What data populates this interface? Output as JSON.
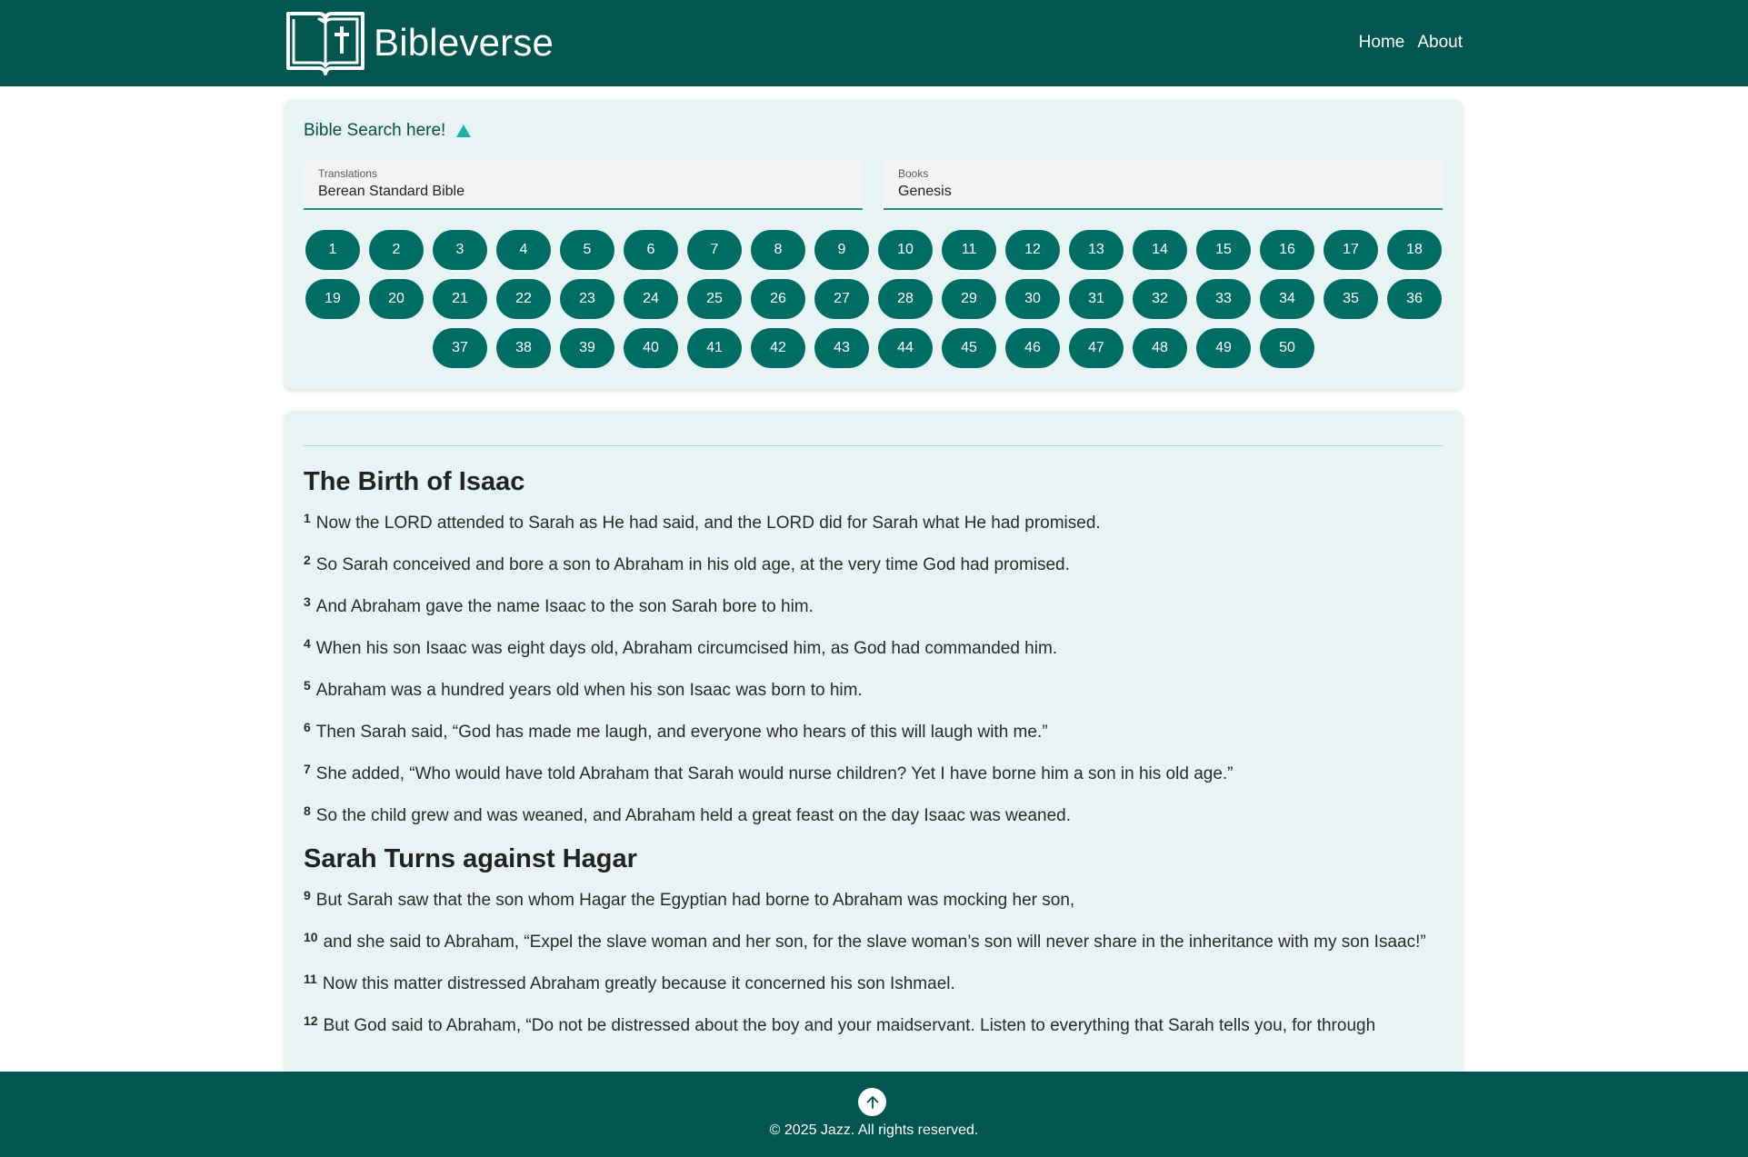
{
  "brand": {
    "name": "Bibleverse",
    "logo_icon": "open-bible-cross-icon"
  },
  "nav": {
    "home": "Home",
    "about": "About"
  },
  "search": {
    "title": "Bible Search here!",
    "toggle_icon": "triangle-up-icon",
    "translations_label": "Translations",
    "translations_value": "Berean Standard Bible",
    "books_label": "Books",
    "books_value": "Genesis",
    "chapters": [
      "1",
      "2",
      "3",
      "4",
      "5",
      "6",
      "7",
      "8",
      "9",
      "10",
      "11",
      "12",
      "13",
      "14",
      "15",
      "16",
      "17",
      "18",
      "19",
      "20",
      "21",
      "22",
      "23",
      "24",
      "25",
      "26",
      "27",
      "28",
      "29",
      "30",
      "31",
      "32",
      "33",
      "34",
      "35",
      "36",
      "37",
      "38",
      "39",
      "40",
      "41",
      "42",
      "43",
      "44",
      "45",
      "46",
      "47",
      "48",
      "49",
      "50"
    ]
  },
  "sections": [
    {
      "heading": "The Birth of Isaac",
      "verses": [
        {
          "num": "1",
          "text": "Now the LORD attended to Sarah as He had said, and the LORD did for Sarah what He had promised."
        },
        {
          "num": "2",
          "text": "So Sarah conceived and bore a son to Abraham in his old age, at the very time God had promised."
        },
        {
          "num": "3",
          "text": "And Abraham gave the name Isaac   to the son Sarah bore to him."
        },
        {
          "num": "4",
          "text": "When his son Isaac was eight days old, Abraham circumcised him, as God had commanded him."
        },
        {
          "num": "5",
          "text": "Abraham was a hundred years old when his son Isaac was born to him."
        },
        {
          "num": "6",
          "text": "Then Sarah said, “God has made me laugh, and everyone who hears of this will laugh with me.”"
        },
        {
          "num": "7",
          "text": "She added, “Who would have told Abraham that Sarah would nurse children? Yet I have borne him a son in his old age.”"
        },
        {
          "num": "8",
          "text": "So the child grew and was weaned, and Abraham held a great feast on the day Isaac was weaned."
        }
      ]
    },
    {
      "heading": "Sarah Turns against Hagar",
      "verses": [
        {
          "num": "9",
          "text": "But Sarah saw that the son whom Hagar the Egyptian had borne to Abraham was mocking her son,"
        },
        {
          "num": "10",
          "text": "and she said to Abraham, “Expel the slave woman and her son, for the slave woman’s son will never share in the inheritance with my son Isaac!”"
        },
        {
          "num": "11",
          "text": "Now this matter distressed Abraham greatly because it concerned his son Ishmael."
        },
        {
          "num": "12",
          "text": "But God said to Abraham, “Do not be distressed about the boy and your maidservant. Listen to everything that Sarah tells you, for through"
        }
      ]
    }
  ],
  "footer": {
    "copyright": "© 2025 Jazz. All rights reserved.",
    "up_icon": "arrow-up-icon"
  },
  "colors": {
    "header_bg": "#02564f",
    "chip_bg": "#006d64",
    "card_bg": "#e7f4f3",
    "accent": "#1bb2a6"
  }
}
